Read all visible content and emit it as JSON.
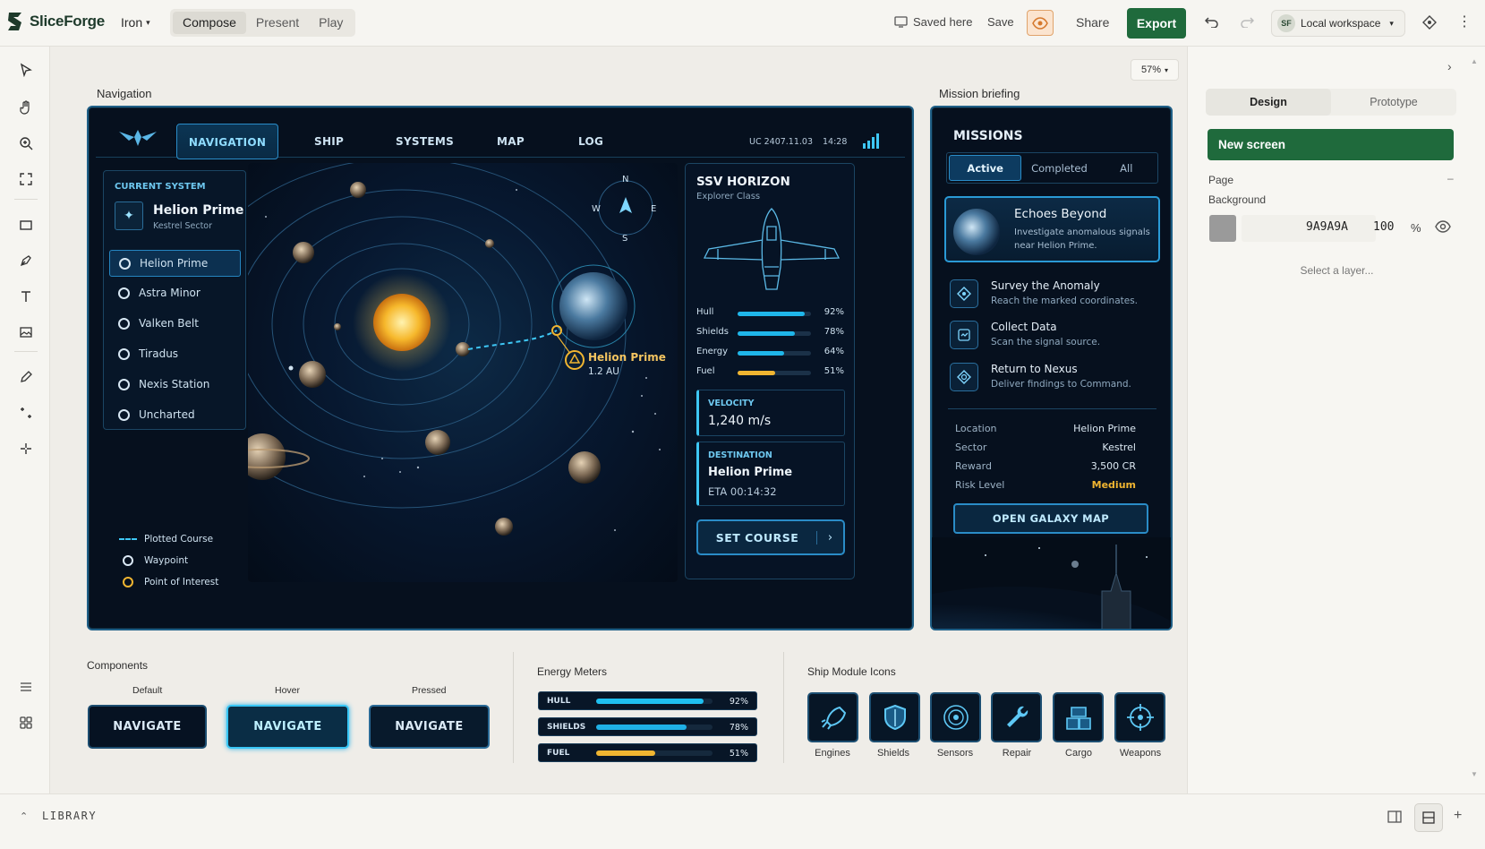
{
  "app": {
    "name": "SliceForge",
    "doc_name": "Iron"
  },
  "modes": [
    "Compose",
    "Present",
    "Play"
  ],
  "toolbar": {
    "saved": "Saved here",
    "save": "Save",
    "share": "Share",
    "export": "Export",
    "workspace_initials": "SF",
    "workspace": "Local workspace"
  },
  "canvas": {
    "zoom": "57%",
    "frame_nav_label": "Navigation",
    "frame_mission_label": "Mission briefing",
    "components_label": "Components",
    "energy_label": "Energy Meters",
    "modules_label": "Ship Module Icons"
  },
  "nav": {
    "tabs": [
      "NAVIGATION",
      "SHIP",
      "SYSTEMS",
      "MAP",
      "LOG"
    ],
    "stardate": "UC 2407.11.03",
    "time": "14:28",
    "current_system_label": "CURRENT SYSTEM",
    "current_system": "Helion Prime",
    "sector": "Kestrel Sector",
    "systems": [
      "Helion Prime",
      "Astra Minor",
      "Valken Belt",
      "Tiradus",
      "Nexis Station",
      "Uncharted"
    ],
    "legend": [
      "Plotted Course",
      "Waypoint",
      "Point of Interest"
    ],
    "compass": {
      "n": "N",
      "s": "S",
      "e": "E",
      "w": "W"
    },
    "target_name": "Helion Prime",
    "target_dist": "1.2 AU"
  },
  "ship": {
    "name": "SSV HORIZON",
    "class": "Explorer Class",
    "meters": [
      {
        "label": "Hull",
        "value": 92,
        "pct": "92%",
        "color": "#1fb6ea"
      },
      {
        "label": "Shields",
        "value": 78,
        "pct": "78%",
        "color": "#1fb6ea"
      },
      {
        "label": "Energy",
        "value": 64,
        "pct": "64%",
        "color": "#1fb6ea"
      },
      {
        "label": "Fuel",
        "value": 51,
        "pct": "51%",
        "color": "#f0b531"
      }
    ],
    "velocity_label": "VELOCITY",
    "velocity": "1,240 m/s",
    "destination_label": "DESTINATION",
    "destination": "Helion Prime",
    "eta": "ETA  00:14:32",
    "set_course": "SET COURSE"
  },
  "missions": {
    "title": "MISSIONS",
    "tabs": [
      "Active",
      "Completed",
      "All"
    ],
    "featured": {
      "title": "Echoes Beyond",
      "desc1": "Investigate anomalous signals",
      "desc2": "near Helion Prime."
    },
    "items": [
      {
        "title": "Survey the Anomaly",
        "desc": "Reach the marked coordinates.",
        "icon": "diamond-icon"
      },
      {
        "title": "Collect Data",
        "desc": "Scan the signal source.",
        "icon": "data-icon"
      },
      {
        "title": "Return to Nexus",
        "desc": "Deliver findings to Command.",
        "icon": "return-icon"
      }
    ],
    "info": [
      {
        "k": "Location",
        "v": "Helion Prime"
      },
      {
        "k": "Sector",
        "v": "Kestrel"
      },
      {
        "k": "Reward",
        "v": "3,500 CR"
      },
      {
        "k": "Risk Level",
        "v": "Medium"
      }
    ],
    "risk_color": "#f0b531",
    "cta": "OPEN GALAXY MAP"
  },
  "components": {
    "states": [
      "Default",
      "Hover",
      "Pressed"
    ],
    "button_label": "NAVIGATE"
  },
  "energy": [
    {
      "label": "HULL",
      "value": 92,
      "pct": "92%",
      "color": "#1fc0f0"
    },
    {
      "label": "SHIELDS",
      "value": 78,
      "pct": "78%",
      "color": "#1fb0e6"
    },
    {
      "label": "FUEL",
      "value": 51,
      "pct": "51%",
      "color": "#f0b531"
    }
  ],
  "modules": [
    "Engines",
    "Shields",
    "Sensors",
    "Repair",
    "Cargo",
    "Weapons"
  ],
  "panel": {
    "tabs": [
      "Design",
      "Prototype"
    ],
    "new_screen": "New screen",
    "page_label": "Page",
    "background_label": "Background",
    "bg_hex": "9A9A9A",
    "bg_opacity": "100",
    "pct_sign": "%",
    "bg_color": "#9a9a9a",
    "empty": "Select a layer..."
  },
  "library": {
    "label": "LIBRARY"
  }
}
